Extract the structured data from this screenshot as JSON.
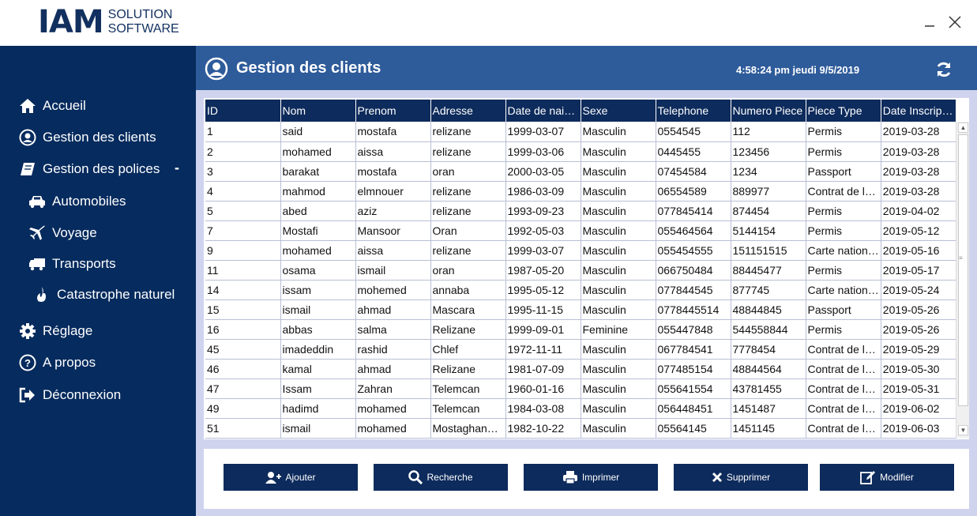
{
  "app": {
    "logo_main": "IAM",
    "logo_sub_1": "SOLUTION",
    "logo_sub_2": "SOFTWARE"
  },
  "sidebar": {
    "items": [
      {
        "label": "Accueil",
        "icon": "home-icon"
      },
      {
        "label": "Gestion des clients",
        "icon": "user-circle-icon"
      },
      {
        "label": "Gestion des polices",
        "icon": "book-icon",
        "expanded_marker": "-"
      },
      {
        "label": "Automobiles",
        "icon": "car-icon"
      },
      {
        "label": "Voyage",
        "icon": "plane-icon"
      },
      {
        "label": "Transports",
        "icon": "truck-icon"
      },
      {
        "label": "Catastrophe naturel",
        "icon": "fire-icon"
      },
      {
        "label": "Réglage",
        "icon": "gear-icon"
      },
      {
        "label": "A propos",
        "icon": "question-icon"
      },
      {
        "label": "Déconnexion",
        "icon": "sign-out-icon"
      }
    ]
  },
  "header": {
    "title": "Gestion des clients",
    "clock": "4:58:24 pm jeudi 9/5/2019"
  },
  "table": {
    "columns": [
      "ID",
      "Nom",
      "Prenom",
      "Adresse",
      "Date de nai…",
      "Sexe",
      "Telephone",
      "Numero Piece",
      "Piece Type",
      "Date Inscrip…"
    ],
    "rows": [
      [
        "1",
        "said",
        "mostafa",
        "relizane",
        "1999-03-07",
        "Masculin",
        "0554545",
        "112",
        "Permis",
        "2019-03-28"
      ],
      [
        "2",
        "mohamed",
        "aissa",
        "relizane",
        "1999-03-06",
        "Masculin",
        "0445455",
        "123456",
        "Permis",
        "2019-03-28"
      ],
      [
        "3",
        "barakat",
        "mostafa",
        "oran",
        "2000-03-05",
        "Masculin",
        "07454584",
        "1234",
        "Passport",
        "2019-03-28"
      ],
      [
        "4",
        "mahmod",
        "elmnouer",
        "relizane",
        "1986-03-09",
        "Masculin",
        "06554589",
        "889977",
        "Contrat de l…",
        "2019-03-28"
      ],
      [
        "5",
        "abed",
        "aziz",
        "relizane",
        "1993-09-23",
        "Masculin",
        "077845414",
        "874454",
        "Permis",
        "2019-04-02"
      ],
      [
        "7",
        "Mostafi",
        "Mansoor",
        "Oran",
        "1992-05-03",
        "Masculin",
        "055464564",
        "5144154",
        "Permis",
        "2019-05-12"
      ],
      [
        "9",
        "mohamed",
        "aissa",
        "relizane",
        "1999-03-07",
        "Masculin",
        "055454555",
        "151151515",
        "Carte nation…",
        "2019-05-16"
      ],
      [
        "11",
        "osama",
        "ismail",
        "oran",
        "1987-05-20",
        "Masculin",
        "066750484",
        "88445477",
        "Permis",
        "2019-05-17"
      ],
      [
        "14",
        "issam",
        "mohemed",
        "annaba",
        "1995-05-12",
        "Masculin",
        "077844545",
        "877745",
        "Carte nation…",
        "2019-05-24"
      ],
      [
        "15",
        "ismail",
        "ahmad",
        "Mascara",
        "1995-11-15",
        "Masculin",
        "0778445514",
        "48844845",
        "Passport",
        "2019-05-26"
      ],
      [
        "16",
        "abbas",
        "salma",
        "Relizane",
        "1999-09-01",
        "Feminine",
        "055447848",
        "544558844",
        "Permis",
        "2019-05-26"
      ],
      [
        "45",
        "imadeddin",
        "rashid",
        "Chlef",
        "1972-11-11",
        "Masculin",
        "067784541",
        "7778454",
        "Contrat de l…",
        "2019-05-29"
      ],
      [
        "46",
        "kamal",
        "ahmad",
        "Relizane",
        "1981-07-09",
        "Masculin",
        "077485154",
        "48844564",
        "Contrat de l…",
        "2019-05-30"
      ],
      [
        "47",
        "Issam",
        "Zahran",
        "Telemcan",
        "1960-01-16",
        "Masculin",
        "055641554",
        "43781455",
        "Contrat de l…",
        "2019-05-31"
      ],
      [
        "49",
        "hadimd",
        "mohamed",
        "Telemcan",
        "1984-03-08",
        "Masculin",
        "056448451",
        "1451487",
        "Contrat de l…",
        "2019-06-02"
      ],
      [
        "51",
        "ismail",
        "mohamed",
        "Mostaghan…",
        "1982-10-22",
        "Masculin",
        "05564145",
        "1451145",
        "Contrat de l…",
        "2019-06-03"
      ]
    ]
  },
  "buttons": {
    "add": "Ajouter",
    "search": "Recherche",
    "print": "Imprimer",
    "delete": "Supprimer",
    "edit": "Modifier"
  },
  "colors": {
    "sidebar_bg": "#062b5e",
    "header_bg": "#2e5b9a",
    "table_header_bg": "#0d2b5c",
    "main_bg": "#cfd3ee"
  }
}
